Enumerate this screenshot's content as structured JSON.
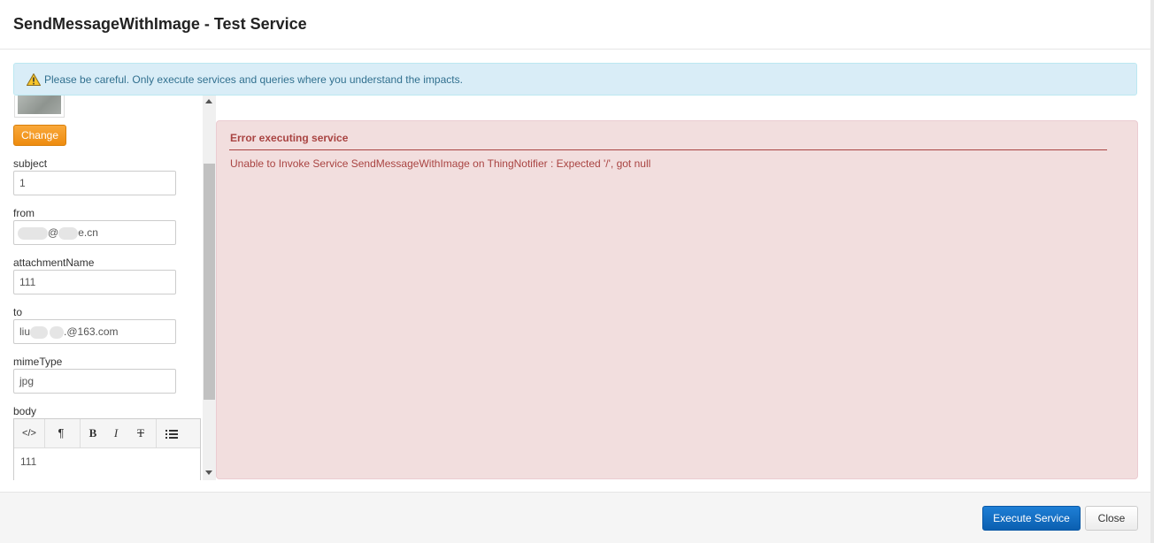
{
  "dialog": {
    "title": "SendMessageWithImage - Test Service"
  },
  "warning": {
    "icon": "warning-triangle-icon",
    "text": "Please be careful. Only execute services and queries where you understand the impacts."
  },
  "params": {
    "change_label": "Change",
    "subject": {
      "label": "subject",
      "value": "1"
    },
    "from": {
      "label": "from",
      "value_visible_part1": "@",
      "value_visible_part2": "e.cn"
    },
    "attachmentName": {
      "label": "attachmentName",
      "value": "111"
    },
    "to": {
      "label": "to",
      "value_visible_part1": "liu",
      "value_visible_part2": ".@163.com"
    },
    "mimeType": {
      "label": "mimeType",
      "value": "jpg"
    },
    "body": {
      "label": "body",
      "value": "111",
      "toolbar": [
        "</>",
        "¶",
        "B",
        "I",
        "T",
        "list-icon"
      ]
    }
  },
  "error": {
    "title": "Error executing service",
    "message": "Unable to Invoke Service SendMessageWithImage on ThingNotifier : Expected '/', got null"
  },
  "footer": {
    "execute_label": "Execute Service",
    "close_label": "Close"
  },
  "colors": {
    "error_text": "#a94442",
    "error_bg": "#f2dede",
    "warning_bg": "#d9edf7",
    "primary": "#0b5fb0",
    "change_orange": "#f29b22"
  }
}
